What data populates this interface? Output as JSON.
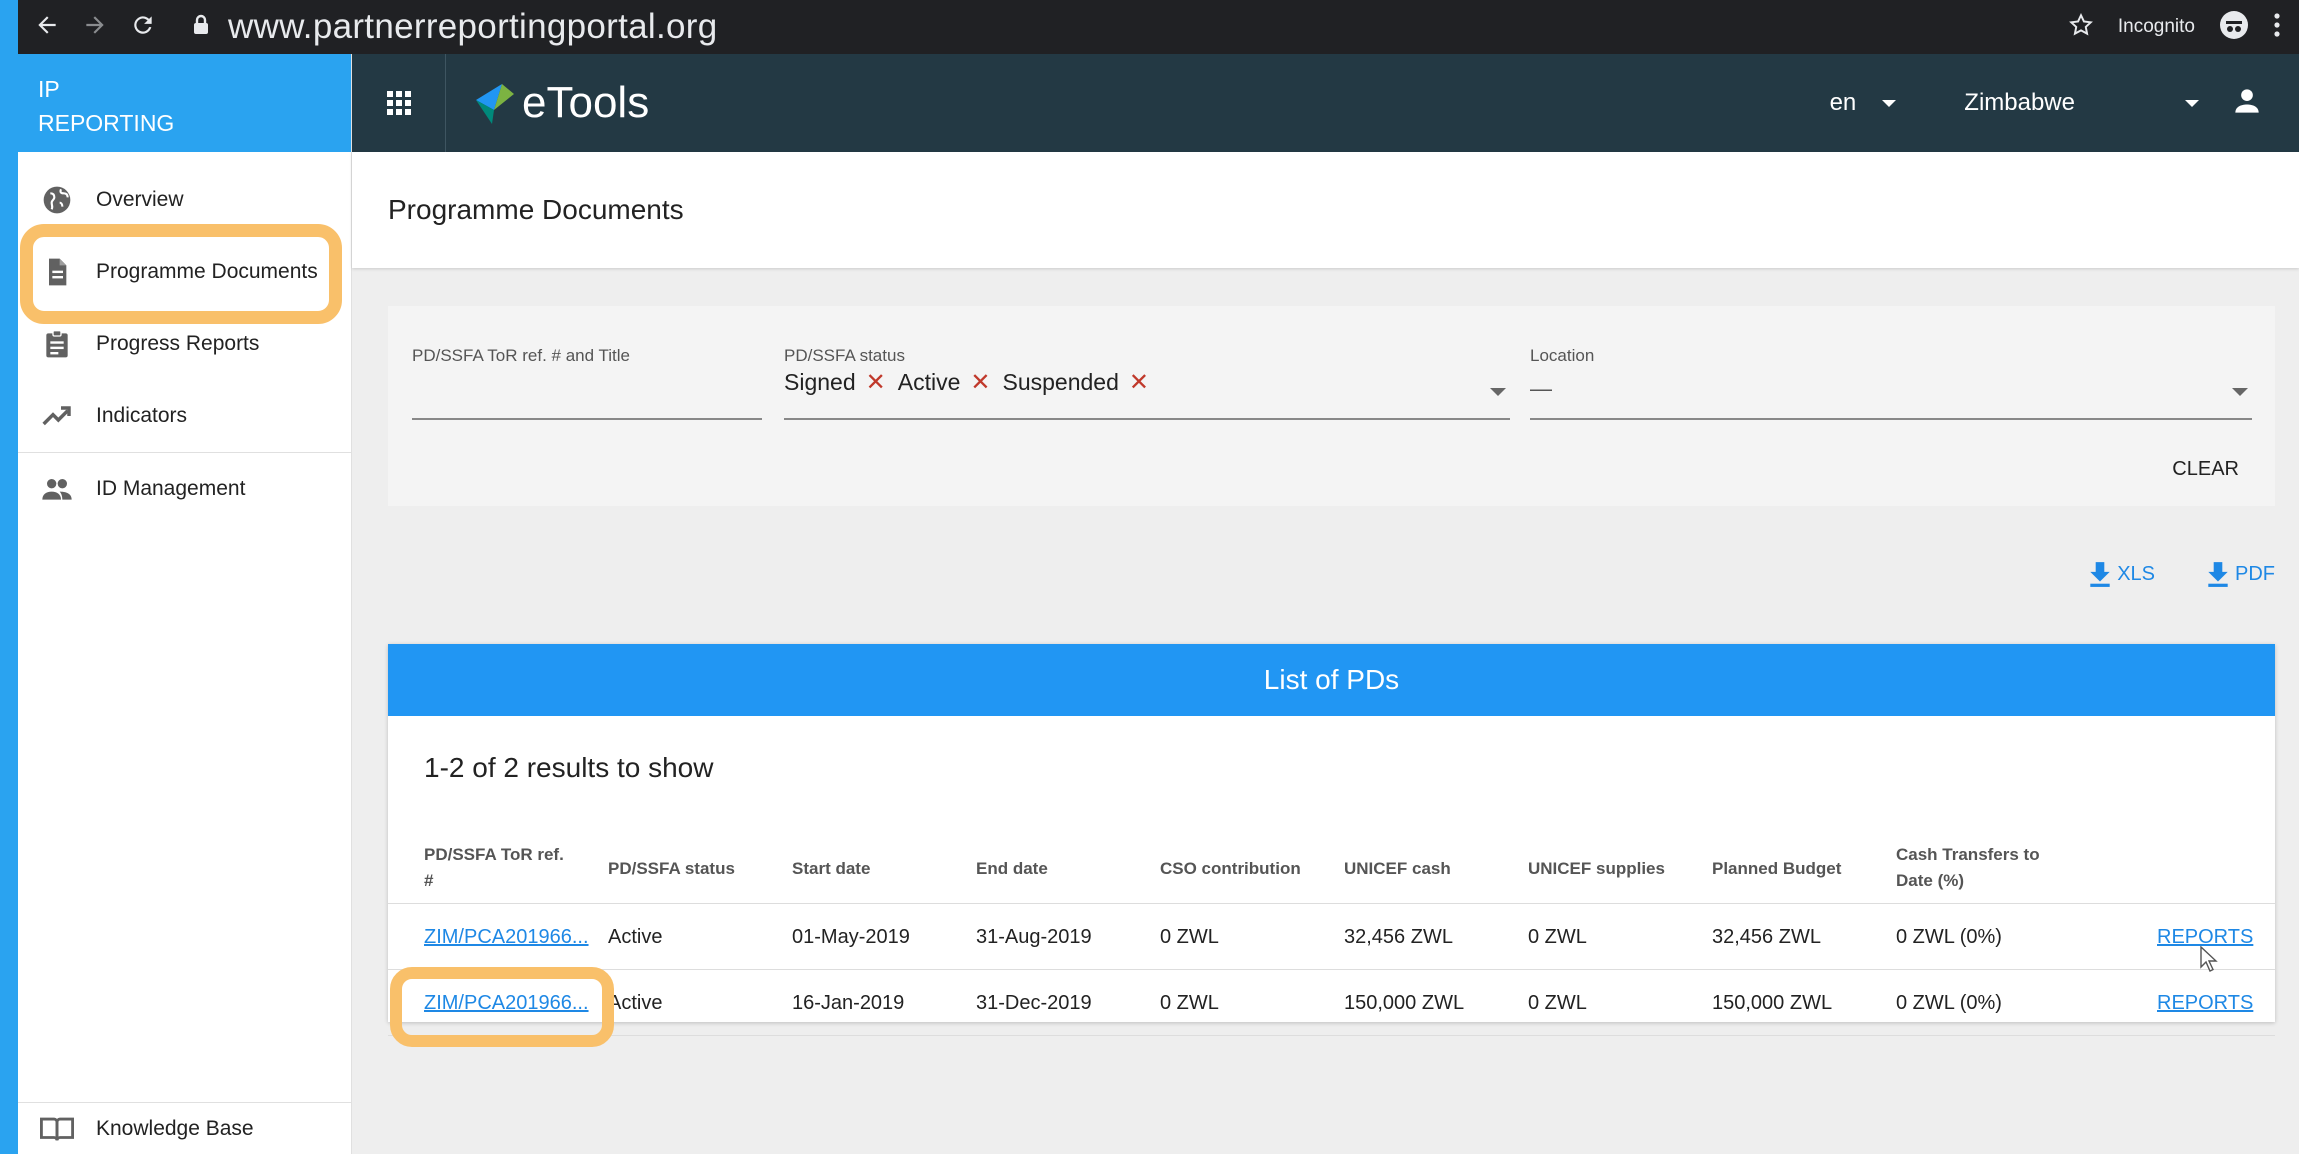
{
  "browser": {
    "url": "www.partnerreportingportal.org",
    "incognito_label": "Incognito"
  },
  "sidebar": {
    "brand_line1": "IP",
    "brand_line2": "REPORTING",
    "items": [
      {
        "label": "Overview",
        "icon": "globe-icon"
      },
      {
        "label": "Programme Documents",
        "icon": "document-icon"
      },
      {
        "label": "Progress Reports",
        "icon": "clipboard-icon"
      },
      {
        "label": "Indicators",
        "icon": "trending-up-icon"
      },
      {
        "label": "ID Management",
        "icon": "people-icon"
      }
    ],
    "footer_label": "Knowledge Base"
  },
  "appbar": {
    "logo_text": "eTools",
    "language": "en",
    "country": "Zimbabwe"
  },
  "page": {
    "title": "Programme Documents"
  },
  "filters": {
    "ref_label": "PD/SSFA ToR ref. # and Title",
    "ref_value": "",
    "status_label": "PD/SSFA status",
    "status_chips": [
      "Signed",
      "Active",
      "Suspended"
    ],
    "location_label": "Location",
    "location_value": "—",
    "clear_label": "CLEAR"
  },
  "exports": {
    "xls_label": "XLS",
    "pdf_label": "PDF"
  },
  "table": {
    "title": "List of PDs",
    "results_text": "1-2 of 2 results to show",
    "headers": {
      "ref_line1": "PD/SSFA ToR ref.",
      "ref_line2": "#",
      "status": "PD/SSFA status",
      "start": "Start date",
      "end": "End date",
      "cso": "CSO contribution",
      "unicef_cash": "UNICEF cash",
      "unicef_supplies": "UNICEF supplies",
      "planned": "Planned Budget",
      "cash_line1": "Cash Transfers to",
      "cash_line2": "Date (%)"
    },
    "rows": [
      {
        "ref": "ZIM/PCA201966...",
        "status": "Active",
        "start": "01-May-2019",
        "end": "31-Aug-2019",
        "cso": "0 ZWL",
        "unicef_cash": "32,456 ZWL",
        "unicef_supplies": "0 ZWL",
        "planned": "32,456 ZWL",
        "cash_transfers": "0 ZWL (0%)",
        "action": "REPORTS"
      },
      {
        "ref": "ZIM/PCA201966...",
        "status": "Active",
        "start": "16-Jan-2019",
        "end": "31-Dec-2019",
        "cso": "0 ZWL",
        "unicef_cash": "150,000 ZWL",
        "unicef_supplies": "0 ZWL",
        "planned": "150,000 ZWL",
        "cash_transfers": "0 ZWL (0%)",
        "action": "REPORTS"
      }
    ]
  }
}
